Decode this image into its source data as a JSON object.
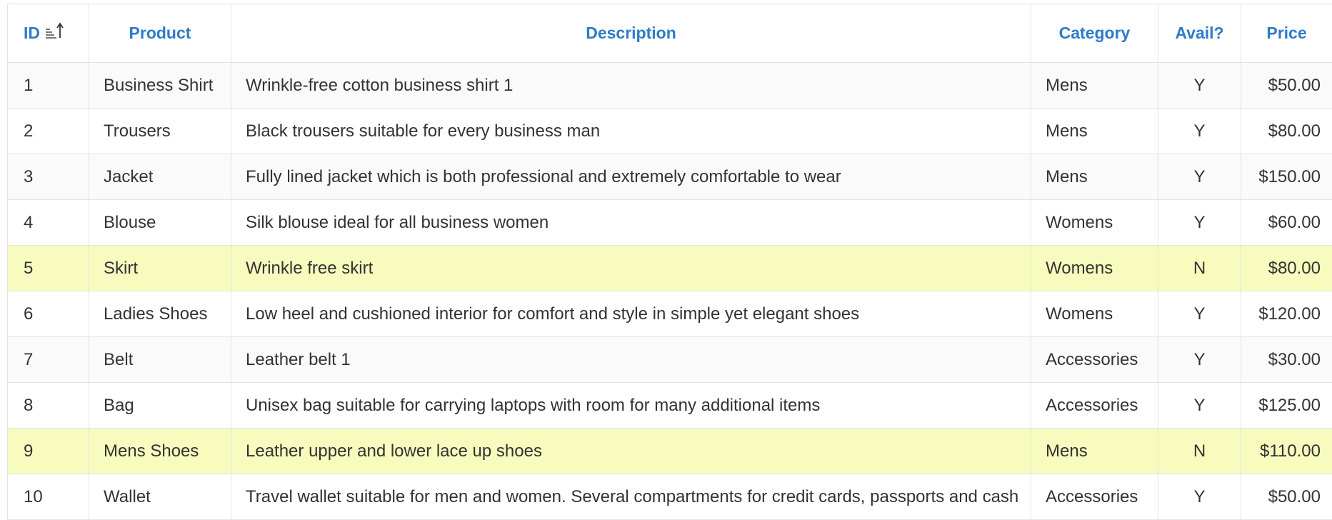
{
  "table": {
    "columns": [
      {
        "key": "id",
        "label": "ID",
        "sort": "ascending"
      },
      {
        "key": "product",
        "label": "Product"
      },
      {
        "key": "description",
        "label": "Description"
      },
      {
        "key": "category",
        "label": "Category"
      },
      {
        "key": "available",
        "label": "Avail?"
      },
      {
        "key": "price",
        "label": "Price"
      }
    ],
    "highlight_color": "#f7fbbd",
    "header_color": "#2f7ac9",
    "rows": [
      {
        "id": "1",
        "product": "Business Shirt",
        "description": "Wrinkle-free cotton business shirt 1",
        "category": "Mens",
        "available": "Y",
        "price": "$50.00"
      },
      {
        "id": "2",
        "product": "Trousers",
        "description": "Black trousers suitable for every business man",
        "category": "Mens",
        "available": "Y",
        "price": "$80.00"
      },
      {
        "id": "3",
        "product": "Jacket",
        "description": "Fully lined jacket which is both professional and extremely comfortable to wear",
        "category": "Mens",
        "available": "Y",
        "price": "$150.00"
      },
      {
        "id": "4",
        "product": "Blouse",
        "description": "Silk blouse ideal for all business women",
        "category": "Womens",
        "available": "Y",
        "price": "$60.00"
      },
      {
        "id": "5",
        "product": "Skirt",
        "description": "Wrinkle free skirt",
        "category": "Womens",
        "available": "N",
        "price": "$80.00"
      },
      {
        "id": "6",
        "product": "Ladies Shoes",
        "description": "Low heel and cushioned interior for comfort and style in simple yet elegant shoes",
        "category": "Womens",
        "available": "Y",
        "price": "$120.00"
      },
      {
        "id": "7",
        "product": "Belt",
        "description": "Leather belt 1",
        "category": "Accessories",
        "available": "Y",
        "price": "$30.00"
      },
      {
        "id": "8",
        "product": "Bag",
        "description": "Unisex bag suitable for carrying laptops with room for many additional items",
        "category": "Accessories",
        "available": "Y",
        "price": "$125.00"
      },
      {
        "id": "9",
        "product": "Mens Shoes",
        "description": "Leather upper and lower lace up shoes",
        "category": "Mens",
        "available": "N",
        "price": "$110.00"
      },
      {
        "id": "10",
        "product": "Wallet",
        "description": "Travel wallet suitable for men and women. Several compartments for credit cards, passports and cash",
        "category": "Accessories",
        "available": "Y",
        "price": "$50.00"
      }
    ]
  }
}
